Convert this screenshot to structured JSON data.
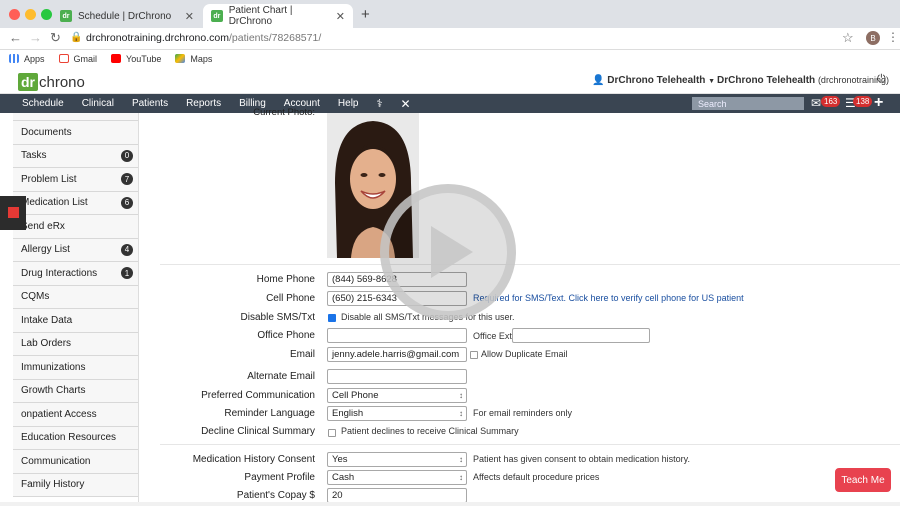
{
  "browser": {
    "tabs": [
      {
        "title": "Schedule | DrChrono",
        "favicon": "dr"
      },
      {
        "title": "Patient Chart | DrChrono",
        "favicon": "dr"
      }
    ],
    "url_host": "drchronotraining.drchrono.com",
    "url_path": "/patients/78268571/",
    "profile_initial": "B",
    "bookmarks": [
      {
        "label": "Apps",
        "icon": "apps-grid-icon"
      },
      {
        "label": "Gmail",
        "icon": "gmail-icon"
      },
      {
        "label": "YouTube",
        "icon": "youtube-icon"
      },
      {
        "label": "Maps",
        "icon": "maps-icon"
      }
    ]
  },
  "app": {
    "logo_dr": "dr",
    "logo_chrono": "chrono",
    "user_menu": "DrChrono Telehealth",
    "account_name": "DrChrono Telehealth",
    "account_sub": "(drchronotraining)",
    "nav": [
      "Schedule",
      "Clinical",
      "Patients",
      "Reports",
      "Billing",
      "Account",
      "Help"
    ],
    "search_placeholder": "Search",
    "messages_count": "163",
    "tasks_count": "138"
  },
  "sidebar": [
    {
      "label": "Documents",
      "badge": ""
    },
    {
      "label": "Tasks",
      "badge": "0"
    },
    {
      "label": "Problem List",
      "badge": "7"
    },
    {
      "label": "Medication List",
      "badge": "6"
    },
    {
      "label": "Send eRx",
      "badge": ""
    },
    {
      "label": "Allergy List",
      "badge": "4"
    },
    {
      "label": "Drug Interactions",
      "badge": "1"
    },
    {
      "label": "CQMs",
      "badge": ""
    },
    {
      "label": "Intake Data",
      "badge": ""
    },
    {
      "label": "Lab Orders",
      "badge": ""
    },
    {
      "label": "Immunizations",
      "badge": ""
    },
    {
      "label": "Growth Charts",
      "badge": ""
    },
    {
      "label": "onpatient Access",
      "badge": ""
    },
    {
      "label": "Education Resources",
      "badge": ""
    },
    {
      "label": "Communication",
      "badge": ""
    },
    {
      "label": "Family History",
      "badge": ""
    }
  ],
  "form": {
    "current_photo_label": "Current Photo:",
    "home_phone_label": "Home Phone",
    "home_phone": "(844) 569-8628",
    "cell_phone_label": "Cell Phone",
    "cell_phone": "(650) 215-6343",
    "cell_note": "Required for SMS/Text. Click here to verify cell phone for US patient",
    "disable_sms_label": "Disable SMS/Txt",
    "disable_sms_note": "Disable all SMS/Txt messages for this user.",
    "office_phone_label": "Office Phone",
    "office_phone": "",
    "office_ext_label": "Office Ext.:",
    "office_ext": "",
    "email_label": "Email",
    "email": "jenny.adele.harris@gmail.com",
    "allow_dup_email": "Allow Duplicate Email",
    "alt_email_label": "Alternate Email",
    "alt_email": "",
    "pref_comm_label": "Preferred Communication",
    "pref_comm": "Cell Phone",
    "reminder_lang_label": "Reminder Language",
    "reminder_lang": "English",
    "reminder_note": "For email reminders only",
    "decline_summary_label": "Decline Clinical Summary",
    "decline_summary_note": "Patient declines to receive Clinical Summary",
    "med_consent_label": "Medication History Consent",
    "med_consent": "Yes",
    "med_consent_note": "Patient has given consent to obtain medication history.",
    "payment_profile_label": "Payment Profile",
    "payment_profile": "Cash",
    "payment_note": "Affects default procedure prices",
    "copay_label": "Patient's Copay $",
    "copay": "20"
  },
  "teach_me": "Teach Me",
  "colors": {
    "nav_bg": "#3a4552",
    "brand_green": "#5fa83a",
    "badge_red": "#d32f2f",
    "teach_red": "#e8424f"
  }
}
